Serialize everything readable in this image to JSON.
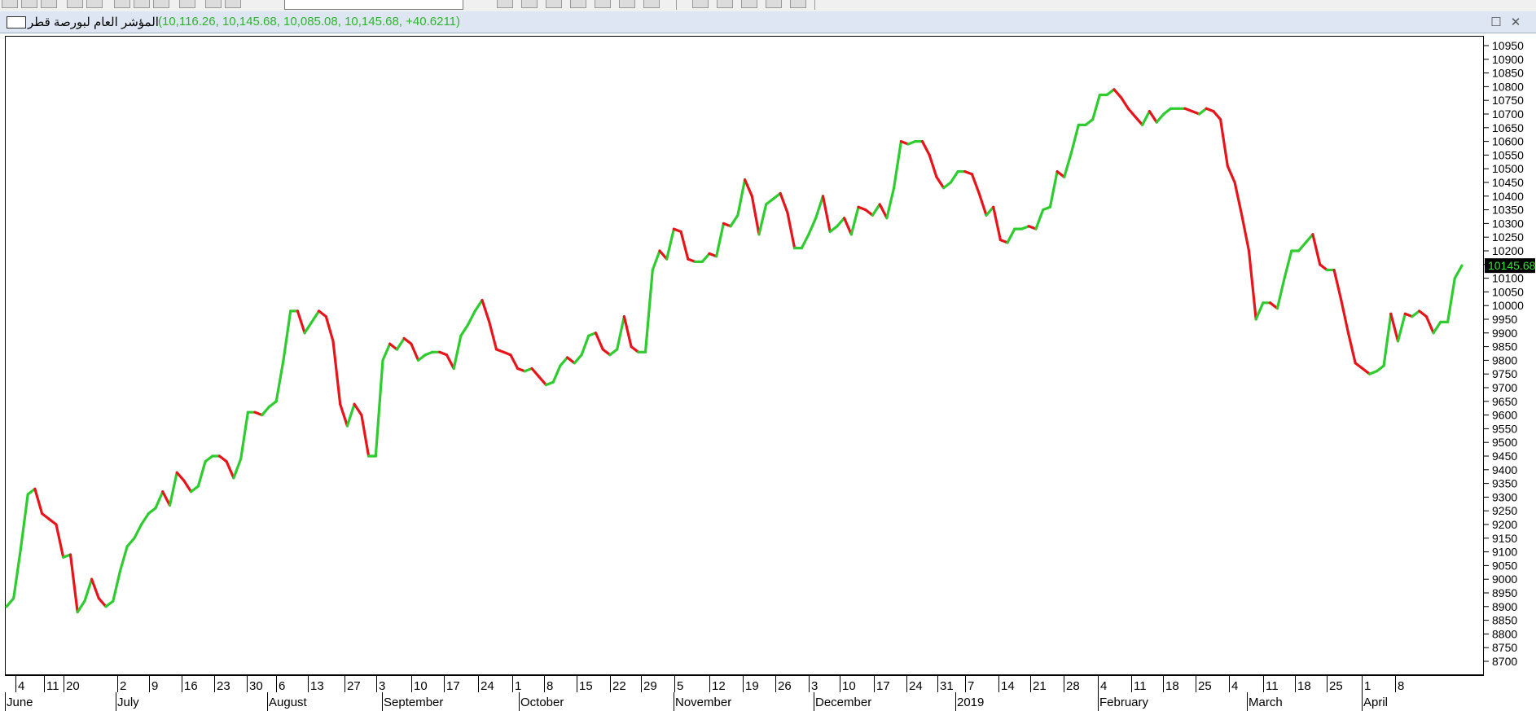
{
  "window": {
    "title": "المؤشر العام لبورصة قطر",
    "ohlc": "(10,116.26, 10,145.68, 10,085.08, 10,145.68, +40.6211)",
    "last_value": "10145.68"
  },
  "colors": {
    "up": "#2ecc2e",
    "down": "#e8141a",
    "last_badge_bg": "#000000",
    "last_badge_fg": "#2ee62e"
  },
  "chart_data": {
    "type": "line",
    "series": [
      {
        "values": [
          8900,
          8930,
          9110,
          9310,
          9330,
          9240,
          9220,
          9200,
          9080,
          9090,
          8880,
          8920,
          9000,
          8930,
          8900,
          8920,
          9030,
          9120,
          9150,
          9200,
          9240,
          9260,
          9320,
          9270,
          9390,
          9360,
          9320,
          9340,
          9430,
          9450,
          9450,
          9430,
          9370,
          9440,
          9610,
          9610,
          9600,
          9630,
          9650,
          9800,
          9980,
          9980,
          9900,
          9940,
          9980,
          9960,
          9870,
          9640,
          9560,
          9640,
          9600,
          9450,
          9450,
          9800,
          9860,
          9840,
          9880,
          9860,
          9800,
          9820,
          9830,
          9830,
          9820,
          9770,
          9890,
          9930,
          9980,
          10020,
          9940,
          9840,
          9830,
          9820,
          9770,
          9760,
          9770,
          9740,
          9710,
          9720,
          9780,
          9810,
          9790,
          9820,
          9890,
          9900,
          9840,
          9820,
          9840,
          9960,
          9850,
          9830,
          9830,
          10130,
          10200,
          10170,
          10280,
          10270,
          10170,
          10160,
          10160,
          10190,
          10180,
          10300,
          10290,
          10330,
          10460,
          10400,
          10260,
          10370,
          10390,
          10410,
          10340,
          10210,
          10210,
          10260,
          10320,
          10400,
          10270,
          10290,
          10320,
          10260,
          10360,
          10350,
          10330,
          10370,
          10320,
          10430,
          10600,
          10590,
          10600,
          10600,
          10550,
          10470,
          10430,
          10450,
          10490,
          10490,
          10480,
          10410,
          10330,
          10360,
          10240,
          10230,
          10280,
          10280,
          10290,
          10280,
          10350,
          10360,
          10490,
          10470,
          10560,
          10660,
          10660,
          10680,
          10770,
          10770,
          10790,
          10760,
          10720,
          10690,
          10660,
          10710,
          10670,
          10700,
          10720,
          10720,
          10720,
          10710,
          10700,
          10720,
          10710,
          10680,
          10510,
          10450,
          10330,
          10200,
          9950,
          10010,
          10010,
          9990,
          10100,
          10200,
          10200,
          10230,
          10260,
          10150,
          10130,
          10130,
          10020,
          9900,
          9790,
          9770,
          9750,
          9760,
          9780,
          9970,
          9870,
          9970,
          9960,
          9980,
          9960,
          9900,
          9940,
          9940,
          10100,
          10146
        ]
      }
    ],
    "ylim": [
      8700,
      10950
    ],
    "y_ticks": [
      "10950",
      "10900",
      "10850",
      "10800",
      "10750",
      "10700",
      "10650",
      "10600",
      "10550",
      "10500",
      "10450",
      "10400",
      "10350",
      "10300",
      "10250",
      "10200",
      "10150",
      "10100",
      "10050",
      "10000",
      "9950",
      "9900",
      "9850",
      "9800",
      "9750",
      "9700",
      "9650",
      "9600",
      "9550",
      "9500",
      "9450",
      "9400",
      "9350",
      "9300",
      "9250",
      "9200",
      "9150",
      "9100",
      "9050",
      "9000",
      "8950",
      "8900",
      "8850",
      "8800",
      "8750",
      "8700"
    ],
    "x_ticks": [
      "4",
      "11",
      "20",
      "2",
      "9",
      "16",
      "23",
      "30",
      "6",
      "13",
      "27",
      "3",
      "10",
      "17",
      "24",
      "1",
      "8",
      "15",
      "22",
      "29",
      "5",
      "12",
      "19",
      "26",
      "3",
      "10",
      "17",
      "24",
      "31",
      "7",
      "14",
      "21",
      "28",
      "4",
      "11",
      "18",
      "25",
      "4",
      "11",
      "18",
      "25",
      "1",
      "8"
    ],
    "x_months": [
      "June",
      "July",
      "August",
      "September",
      "October",
      "November",
      "December",
      "2019",
      "February",
      "March",
      "April"
    ]
  }
}
